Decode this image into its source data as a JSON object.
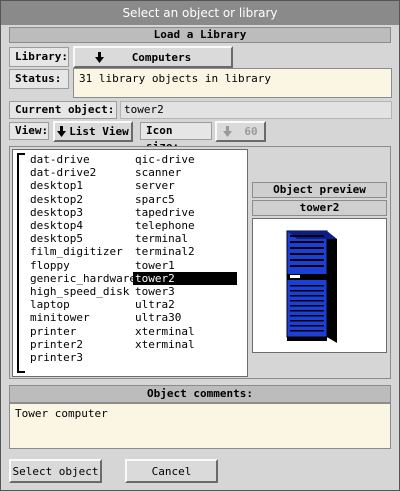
{
  "window": {
    "title": "Select an object or library"
  },
  "load_section": {
    "header": "Load a Library"
  },
  "library": {
    "label": "Library:",
    "value": "Computers"
  },
  "status": {
    "label": "Status:",
    "text": "31 library objects in library"
  },
  "current_object": {
    "label": "Current object:",
    "value": "tower2"
  },
  "view": {
    "label": "View:",
    "button": "List View"
  },
  "icon_size": {
    "label": "Icon size:",
    "value": "60"
  },
  "objects": {
    "column1": [
      "dat-drive",
      "dat-drive2",
      "desktop1",
      "desktop2",
      "desktop3",
      "desktop4",
      "desktop5",
      "film_digitizer",
      "floppy",
      "generic_hardware",
      "high_speed_disk",
      "laptop",
      "minitower",
      "printer",
      "printer2",
      "printer3"
    ],
    "column2": [
      "qic-drive",
      "scanner",
      "server",
      "sparc5",
      "tapedrive",
      "telephone",
      "terminal",
      "terminal2",
      "tower1",
      "tower2",
      "tower3",
      "ultra2",
      "ultra30",
      "xterminal",
      "xterminal"
    ],
    "selected": "tower2"
  },
  "preview": {
    "header": "Object preview",
    "name": "tower2",
    "icon": "tower-computer-icon"
  },
  "comments": {
    "header": "Object comments:",
    "text": "Tower computer"
  },
  "actions": {
    "select": "Select object",
    "cancel": "Cancel"
  },
  "colors": {
    "accent_blue": "#1c3fd8",
    "field_bg": "#fbf6e4",
    "title_bg": "#8a8a8a"
  }
}
